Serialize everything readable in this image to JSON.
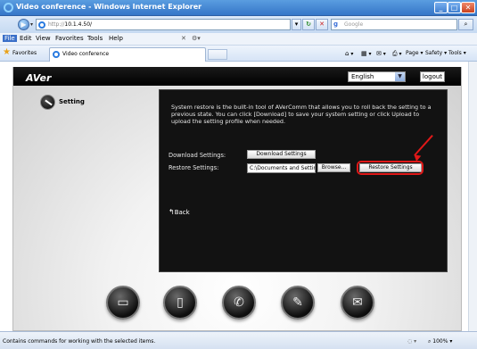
{
  "window": {
    "title": "Video conference - Windows Internet Explorer"
  },
  "address_bar": {
    "protocol": "http://",
    "host": "10.1.4.50/",
    "search_placeholder": "Google"
  },
  "menu": {
    "items": [
      "File",
      "Edit",
      "View",
      "Favorites",
      "Tools",
      "Help"
    ]
  },
  "favorites_bar": {
    "favorites_label": "Favorites",
    "tab_title": "Video conference",
    "commands": [
      "Page",
      "Safety",
      "Tools"
    ]
  },
  "app": {
    "logo": "AVer",
    "language": {
      "selected": "English"
    },
    "logout_label": "logout",
    "section_label": "Setting",
    "description": "System restore is the built-in tool of AVerComm that allows you to roll back the setting to a previous state. You can click [Download] to save your system setting or click Upload to upload the setting profile when needed.",
    "download": {
      "label": "Download Settings:",
      "button": "Download Settings"
    },
    "restore": {
      "label": "Restore Settings:",
      "path_value": "C:\\Documents and Settings",
      "browse_button": "Browse...",
      "restore_button": "Restore Settings"
    },
    "back_label": "Back",
    "bottom_nav": [
      {
        "icon": "monitor-icon"
      },
      {
        "icon": "phonebook-icon"
      },
      {
        "icon": "phone-call-icon"
      },
      {
        "icon": "wrench-icon"
      },
      {
        "icon": "envelope-icon"
      }
    ]
  },
  "status_bar": {
    "text": "Contains commands for working with the selected items.",
    "zoom": "100%"
  },
  "colors": {
    "accent_red": "#e01818",
    "titlebar_blue": "#3576c8",
    "panel_bg": "#121212"
  }
}
